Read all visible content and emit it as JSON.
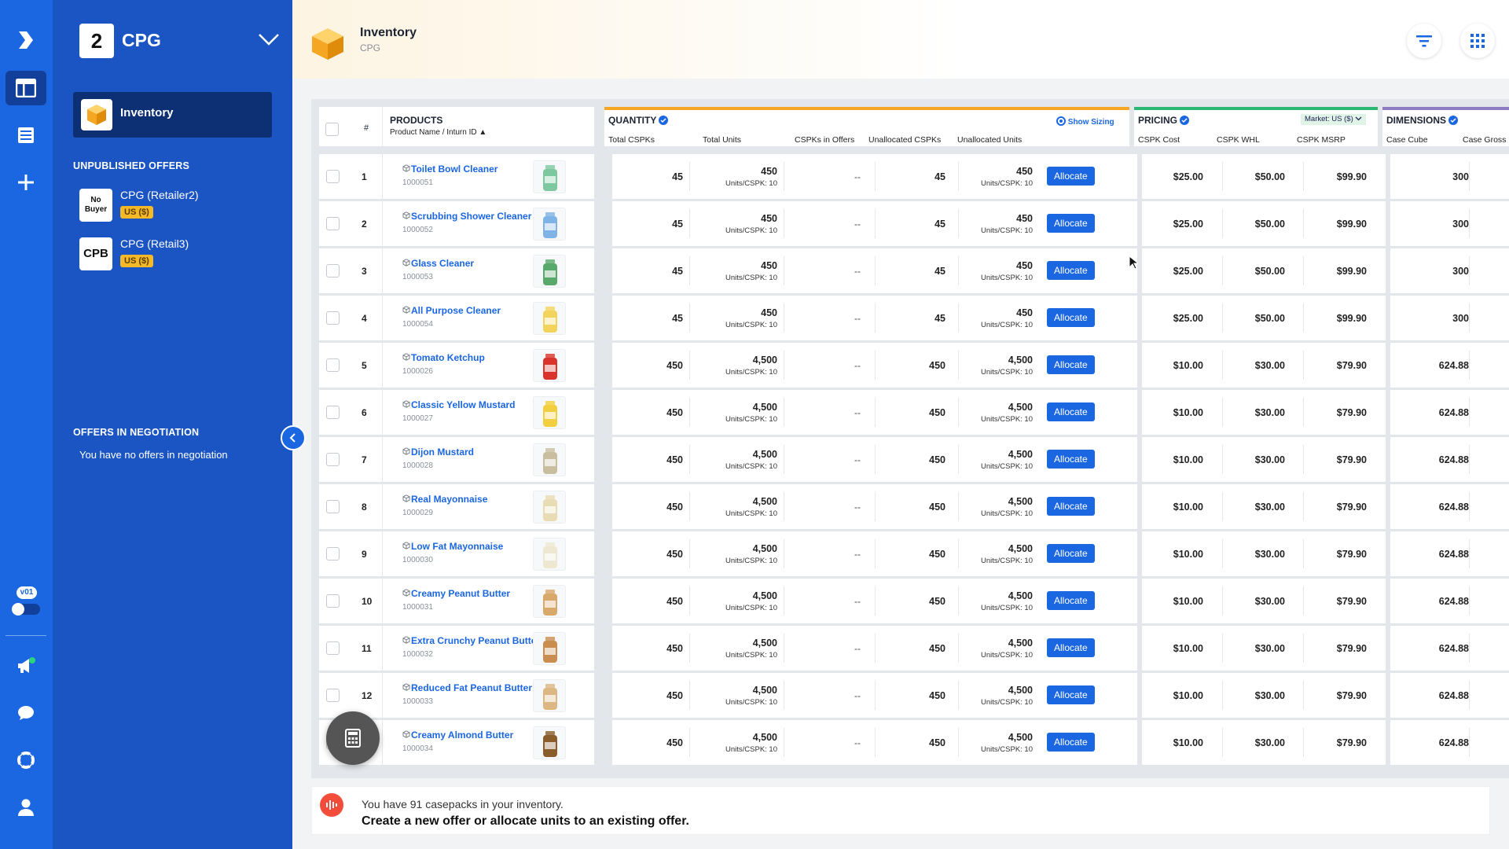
{
  "sidebar": {
    "org_number": "2",
    "org_name": "CPG",
    "nav_active": "Inventory",
    "unpublished_heading": "UNPUBLISHED OFFERS",
    "offers": [
      {
        "badge_line1": "No",
        "badge_line2": "Buyer",
        "name": "CPG (Retailer2)",
        "currency": "US ($)"
      },
      {
        "badge": "CPB",
        "name": "CPG (Retail3)",
        "currency": "US ($)"
      }
    ],
    "negotiation_heading": "OFFERS IN NEGOTIATION",
    "negotiation_empty": "You have no offers in negotiation",
    "version": "v01"
  },
  "header": {
    "title": "Inventory",
    "subtitle": "CPG"
  },
  "table": {
    "hash": "#",
    "products_title": "PRODUCTS",
    "products_sub": "Product Name / Inturn ID ▲",
    "quantity_title": "QUANTITY",
    "show_sizing": "Show Sizing",
    "quantity_cols": [
      "Total CSPKs",
      "Total Units",
      "CSPKs in Offers",
      "Unallocated CSPKs",
      "Unallocated Units"
    ],
    "pricing_title": "PRICING",
    "market_label": "Market: US ($)",
    "pricing_cols": [
      "CSPK Cost",
      "CSPK WHL",
      "CSPK MSRP"
    ],
    "dimensions_title": "DIMENSIONS",
    "dimension_cols": [
      "Case Cube",
      "Case Gross"
    ],
    "units_per_label": "Units/CSPK: 10",
    "allocate_label": "Allocate",
    "rows": [
      {
        "n": "1",
        "name": "Toilet Bowl Cleaner",
        "id": "1000051",
        "cspk": "45",
        "units": "450",
        "offers": "--",
        "ucspk": "45",
        "uunits": "450",
        "cost": "$25.00",
        "whl": "$50.00",
        "msrp": "$99.90",
        "cube": "300"
      },
      {
        "n": "2",
        "name": "Scrubbing Shower Cleaner",
        "id": "1000052",
        "cspk": "45",
        "units": "450",
        "offers": "--",
        "ucspk": "45",
        "uunits": "450",
        "cost": "$25.00",
        "whl": "$50.00",
        "msrp": "$99.90",
        "cube": "300"
      },
      {
        "n": "3",
        "name": "Glass Cleaner",
        "id": "1000053",
        "cspk": "45",
        "units": "450",
        "offers": "--",
        "ucspk": "45",
        "uunits": "450",
        "cost": "$25.00",
        "whl": "$50.00",
        "msrp": "$99.90",
        "cube": "300"
      },
      {
        "n": "4",
        "name": "All Purpose Cleaner",
        "id": "1000054",
        "cspk": "45",
        "units": "450",
        "offers": "--",
        "ucspk": "45",
        "uunits": "450",
        "cost": "$25.00",
        "whl": "$50.00",
        "msrp": "$99.90",
        "cube": "300"
      },
      {
        "n": "5",
        "name": "Tomato Ketchup",
        "id": "1000026",
        "cspk": "450",
        "units": "4,500",
        "offers": "--",
        "ucspk": "450",
        "uunits": "4,500",
        "cost": "$10.00",
        "whl": "$30.00",
        "msrp": "$79.90",
        "cube": "624.88"
      },
      {
        "n": "6",
        "name": "Classic Yellow Mustard",
        "id": "1000027",
        "cspk": "450",
        "units": "4,500",
        "offers": "--",
        "ucspk": "450",
        "uunits": "4,500",
        "cost": "$10.00",
        "whl": "$30.00",
        "msrp": "$79.90",
        "cube": "624.88"
      },
      {
        "n": "7",
        "name": "Dijon Mustard",
        "id": "1000028",
        "cspk": "450",
        "units": "4,500",
        "offers": "--",
        "ucspk": "450",
        "uunits": "4,500",
        "cost": "$10.00",
        "whl": "$30.00",
        "msrp": "$79.90",
        "cube": "624.88"
      },
      {
        "n": "8",
        "name": "Real Mayonnaise",
        "id": "1000029",
        "cspk": "450",
        "units": "4,500",
        "offers": "--",
        "ucspk": "450",
        "uunits": "4,500",
        "cost": "$10.00",
        "whl": "$30.00",
        "msrp": "$79.90",
        "cube": "624.88"
      },
      {
        "n": "9",
        "name": "Low Fat Mayonnaise",
        "id": "1000030",
        "cspk": "450",
        "units": "4,500",
        "offers": "--",
        "ucspk": "450",
        "uunits": "4,500",
        "cost": "$10.00",
        "whl": "$30.00",
        "msrp": "$79.90",
        "cube": "624.88"
      },
      {
        "n": "10",
        "name": "Creamy Peanut Butter",
        "id": "1000031",
        "cspk": "450",
        "units": "4,500",
        "offers": "--",
        "ucspk": "450",
        "uunits": "4,500",
        "cost": "$10.00",
        "whl": "$30.00",
        "msrp": "$79.90",
        "cube": "624.88"
      },
      {
        "n": "11",
        "name": "Extra Crunchy Peanut Butter",
        "id": "1000032",
        "cspk": "450",
        "units": "4,500",
        "offers": "--",
        "ucspk": "450",
        "uunits": "4,500",
        "cost": "$10.00",
        "whl": "$30.00",
        "msrp": "$79.90",
        "cube": "624.88"
      },
      {
        "n": "12",
        "name": "Reduced Fat Peanut Butter",
        "id": "1000033",
        "cspk": "450",
        "units": "4,500",
        "offers": "--",
        "ucspk": "450",
        "uunits": "4,500",
        "cost": "$10.00",
        "whl": "$30.00",
        "msrp": "$79.90",
        "cube": "624.88"
      },
      {
        "n": "",
        "name": "Creamy Almond Butter",
        "id": "1000034",
        "cspk": "450",
        "units": "4,500",
        "offers": "--",
        "ucspk": "450",
        "uunits": "4,500",
        "cost": "$10.00",
        "whl": "$30.00",
        "msrp": "$79.90",
        "cube": "624.88"
      }
    ]
  },
  "footer": {
    "line1": "You have 91 casepacks in your inventory.",
    "line2": "Create a new offer or allocate units to an existing offer."
  },
  "colors": {
    "primary": "#1b66e1",
    "sidebar": "#1b55c3",
    "quantity_bar": "#f5a623",
    "pricing_bar": "#2bb673",
    "dimensions_bar": "#8e7cc3",
    "currency_badge": "#f5b928"
  }
}
